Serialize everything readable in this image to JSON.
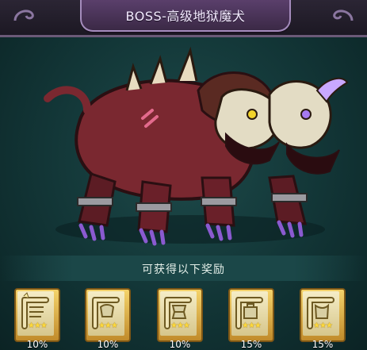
{
  "header": {
    "title": "BOSS-高级地狱魔犬"
  },
  "boss": {
    "name": "高级地狱魔犬",
    "icon": "hellhound-two-headed"
  },
  "rewards": {
    "title": "可获得以下奖励",
    "items": [
      {
        "icon": "scroll-icon",
        "stars": "★★★",
        "rate": "10%"
      },
      {
        "icon": "scroll-icon",
        "stars": "★★★",
        "rate": "10%"
      },
      {
        "icon": "scroll-icon",
        "stars": "★★★",
        "rate": "10%"
      },
      {
        "icon": "scroll-icon",
        "stars": "★★★",
        "rate": "15%"
      },
      {
        "icon": "scroll-icon",
        "stars": "★★★",
        "rate": "15%"
      }
    ]
  },
  "colors": {
    "frame": "#6b5a78",
    "title_plate": "#5a3f6b",
    "background": "#123536",
    "card_gold": "#e1b24b"
  }
}
